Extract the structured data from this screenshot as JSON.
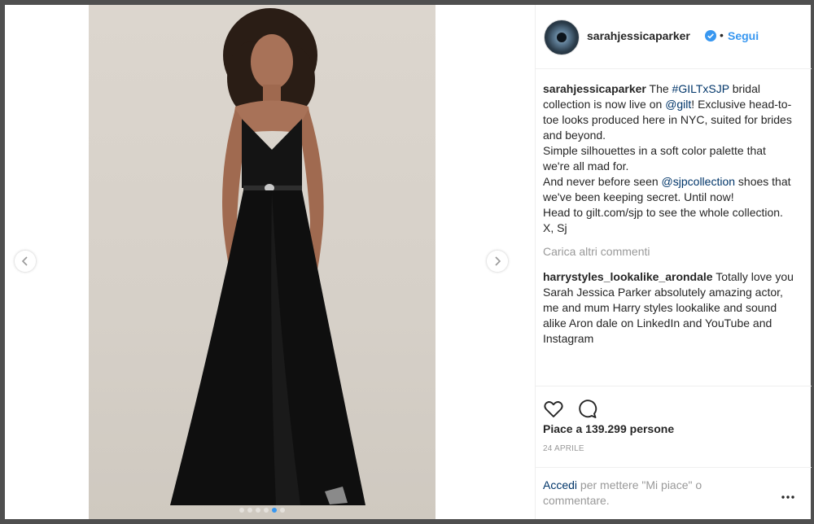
{
  "post": {
    "author": "sarahjessicaparker",
    "separator": "•",
    "follow_label": "Segui",
    "caption_lines": [
      {
        "user": "sarahjessicaparker",
        "t1": " The ",
        "tag1": "#GILTxSJP",
        "t2": " bridal collection is now live on ",
        "tag2": "@gilt",
        "t3": "! Exclusive head-to-toe looks produced here in NYC, suited for brides and beyond."
      }
    ],
    "caption_p2": "Simple silhouettes in a soft color palette that we're all mad for.",
    "caption_p3_a": "And never before seen ",
    "caption_p3_tag": "@sjpcollection",
    "caption_p3_b": " shoes that we've been keeping secret. Until now!",
    "caption_p4": "Head to gilt.com/sjp to see the whole collection.",
    "caption_p5": "X, Sj",
    "load_more": "Carica altri commenti",
    "comment_user": "harrystyles_lookalike_arondale",
    "comment_text": " Totally love you Sarah Jessica Parker absolutely amazing actor, me and mum Harry styles lookalike and sound alike Aron dale on LinkedIn and YouTube and Instagram",
    "likes_text": "Piace a 139.299 persone",
    "date": "24 APRILE",
    "login_link": "Accedi",
    "login_rest": " per mettere \"Mi piace\" o commentare.",
    "carousel_count": 6,
    "carousel_active": 4
  },
  "colors": {
    "accent": "#3897f0",
    "link": "#003569",
    "muted": "#999999",
    "text": "#262626"
  },
  "icons": [
    "chevron-left-icon",
    "chevron-right-icon",
    "verified-badge-icon",
    "heart-icon",
    "comment-icon",
    "more-options-icon"
  ]
}
